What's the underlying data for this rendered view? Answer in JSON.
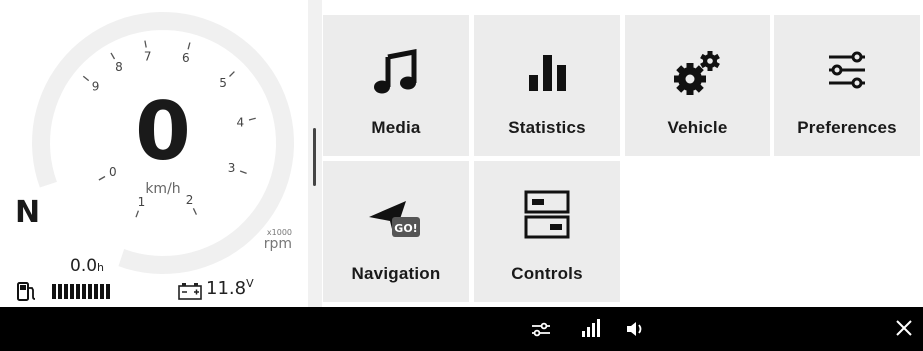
{
  "dashboard": {
    "speed": "0",
    "speed_unit": "km/h",
    "gear": "N",
    "rpm_multiplier": "x1000",
    "rpm_unit": "rpm",
    "rpm_ticks": [
      "0",
      "1",
      "2",
      "3",
      "4",
      "5",
      "6",
      "7",
      "8",
      "9"
    ],
    "trip_value": "0.0",
    "trip_unit": "h",
    "fuel_level_bars": 10,
    "voltage_value": "11.8",
    "voltage_unit": "V"
  },
  "menu": {
    "tiles": [
      {
        "label": "Media",
        "icon": "music-note-icon"
      },
      {
        "label": "Statistics",
        "icon": "bar-chart-icon"
      },
      {
        "label": "Vehicle",
        "icon": "gears-icon"
      },
      {
        "label": "Preferences",
        "icon": "sliders-icon"
      },
      {
        "label": "Navigation",
        "icon": "navigation-go-icon",
        "badge": "GO!"
      },
      {
        "label": "Controls",
        "icon": "controls-panel-icon"
      }
    ]
  },
  "bottom_bar": {
    "icons": [
      "sliders-icon",
      "signal-icon",
      "volume-icon",
      "close-icon"
    ]
  }
}
